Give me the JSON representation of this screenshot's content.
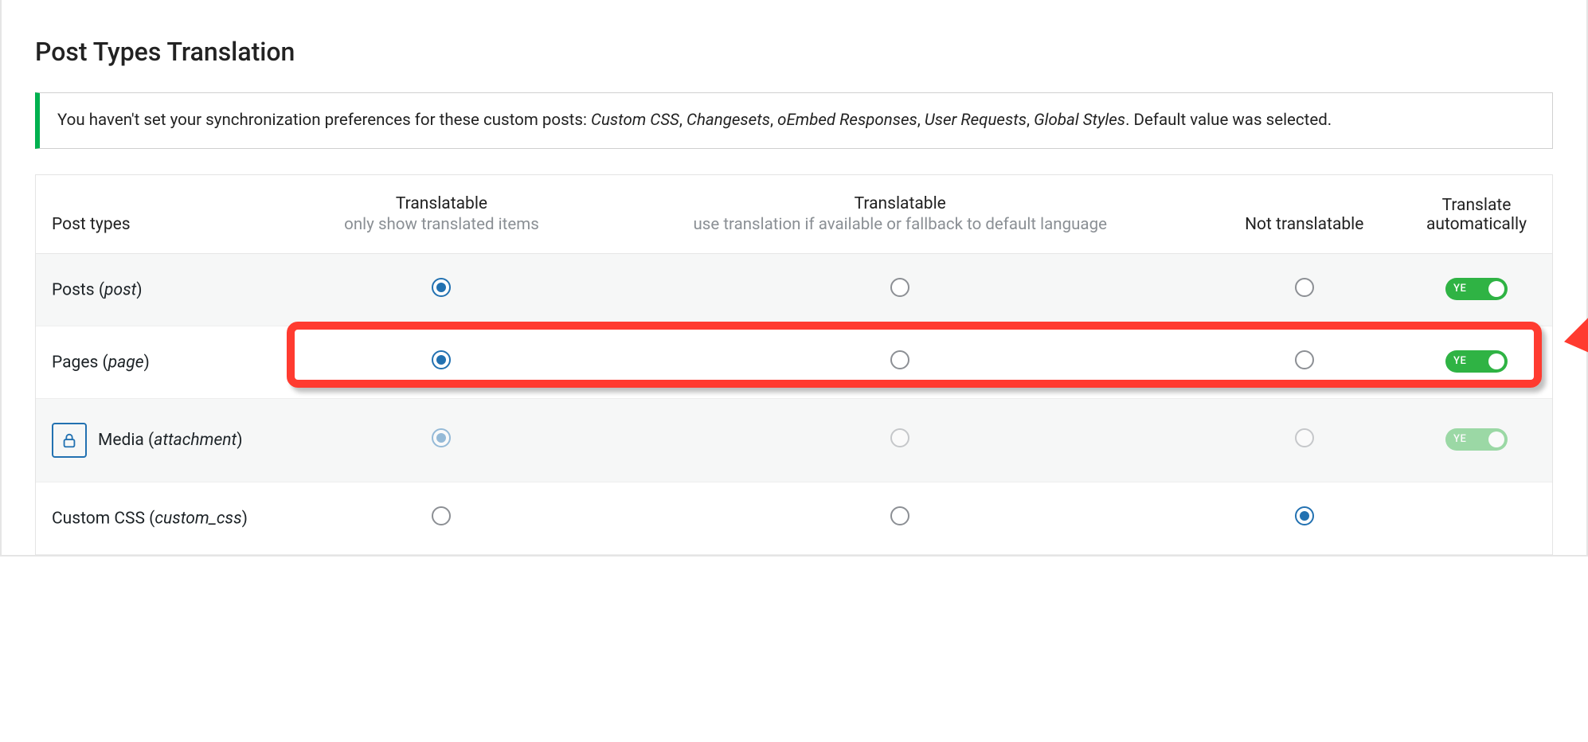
{
  "title": "Post Types Translation",
  "notice": {
    "prefix": "You haven't set your synchronization preferences for these custom posts: ",
    "items": [
      "Custom CSS",
      "Changesets",
      "oEmbed Responses",
      "User Requests",
      "Global Styles"
    ],
    "suffix": ". Default value was selected."
  },
  "columns": {
    "name": "Post types",
    "c1": "Translatable",
    "c1_sub": "only show translated items",
    "c2": "Translatable",
    "c2_sub": "use translation if available or fallback to default language",
    "c3": "Not translatable",
    "c4": "Translate automatically"
  },
  "toggle_label": "YE",
  "rows": [
    {
      "label": "Posts",
      "slug": "post",
      "selected": 0,
      "auto": true,
      "locked": false,
      "highlighted": false
    },
    {
      "label": "Pages",
      "slug": "page",
      "selected": 0,
      "auto": true,
      "locked": false,
      "highlighted": true
    },
    {
      "label": "Media",
      "slug": "attachment",
      "selected": 0,
      "auto": true,
      "locked": true,
      "highlighted": false
    },
    {
      "label": "Custom CSS",
      "slug": "custom_css",
      "selected": 2,
      "auto": false,
      "locked": false,
      "highlighted": false
    }
  ]
}
